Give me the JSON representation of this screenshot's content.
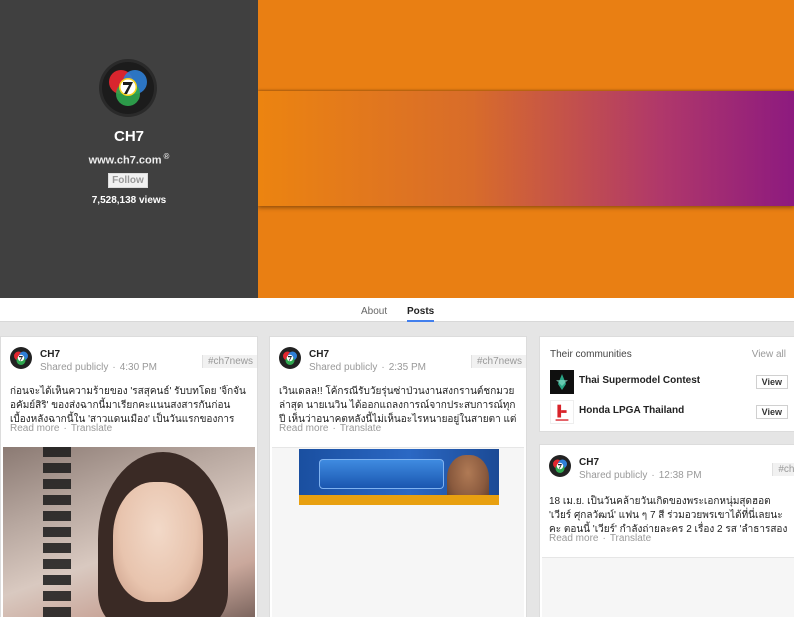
{
  "profile": {
    "name": "CH7",
    "website": "www.ch7.com",
    "follow_label": "Follow",
    "views": "7,528,138 views"
  },
  "tabs": [
    {
      "label": "About"
    },
    {
      "label": "Posts"
    }
  ],
  "posts": [
    {
      "author": "CH7",
      "visibility": "Shared publicly",
      "time": "4:30 PM",
      "hashtag": "#ch7news",
      "text": "ก่อนจะได้เห็นความร้ายของ 'รสสุคนธ์' รับบทโดย 'จิ๊กจั๋น อคัมย์สิริ' ของส่งฉากนี้มาเรียกคะแนนสงสารกันก่อน เบื้องหลังฉากนี้ใน 'สาวแดนเมือง' เป็นวันแรกของการถ่ายทำ 'จิ๊กจั๋น'",
      "read_more": "Read more",
      "translate": "Translate"
    },
    {
      "author": "CH7",
      "visibility": "Shared publicly",
      "time": "2:35 PM",
      "hashtag": "#ch7news",
      "text": "เวินเดลล!! โค้กรณีรับวัยรุ่นซ่าป่วนงานสงกรานต์ชกมวย ล่าสุด นายเนวิน ได้ออกแถลงการณ์จากประสบการณ์ทุกปี เห็นว่าอนาคตหลังนี้ไม่เห็นอะไรหนายอยู่ในสายตา แต่จะระดมด้วย",
      "read_more": "Read more",
      "translate": "Translate"
    },
    {
      "author": "CH7",
      "visibility": "Shared publicly",
      "time": "12:38 PM",
      "hashtag": "#ch7",
      "text": "18 เม.ย. เป็นวันคล้ายวันเกิดของพระเอกหนุ่มสุดฮอต 'เวียร์ ศุกลวัฒน์' แฟน ๆ 7 สี ร่วมอวยพรเขาได้ที่นี่เลยนะคะ ตอนนี้ 'เวียร์' กำลังถ่ายละคร 2 เรื่อง 2 รส 'ลำธารสองขอบฟ้า' และ",
      "read_more": "Read more",
      "translate": "Translate"
    }
  ],
  "communities": {
    "title": "Their communities",
    "view_all": "View all",
    "items": [
      {
        "name": "Thai Supermodel Contest",
        "button": "View"
      },
      {
        "name": "Honda LPGA Thailand",
        "button": "View"
      }
    ]
  },
  "colors": {
    "cover_orange": "#e97f13",
    "cover_purple": "#8d1a7f",
    "profile_bg": "#404040",
    "tab_accent": "#427fed"
  }
}
